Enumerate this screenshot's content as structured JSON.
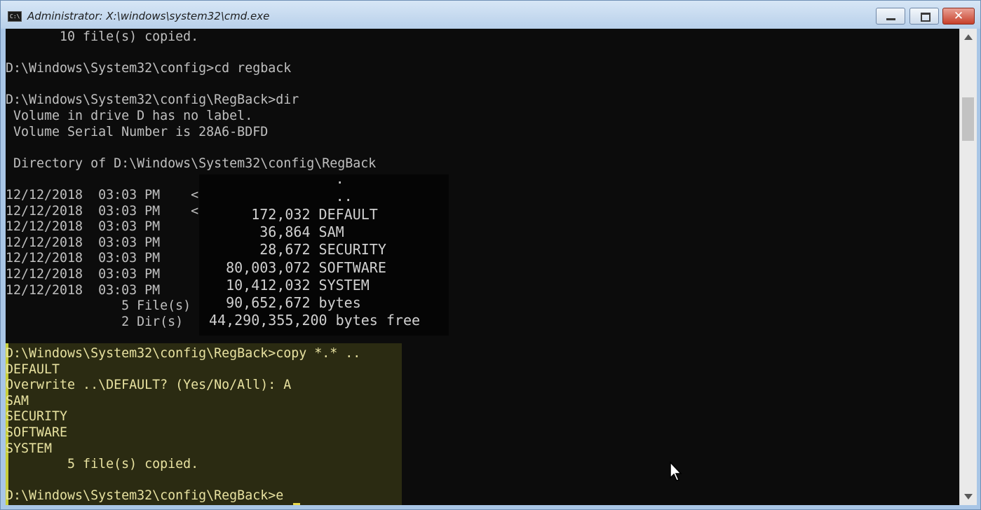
{
  "window": {
    "title": "Administrator: X:\\windows\\system32\\cmd.exe",
    "icon": "cmd-icon",
    "icon_text": "C:\\",
    "controls": {
      "minimize": "minimize-icon",
      "maximize": "maximize-icon",
      "close": "close-icon",
      "close_glyph": "✕"
    }
  },
  "colors": {
    "console_bg": "#0c0c0c",
    "console_text": "#c0c0c0",
    "highlight_text": "#e8e2a0",
    "highlight_border": "#c9cf3c",
    "cursor": "#e8d84a"
  },
  "console": {
    "lines": [
      "       10 file(s) copied.",
      "",
      "D:\\Windows\\System32\\config>cd regback",
      "",
      "D:\\Windows\\System32\\config\\RegBack>dir",
      " Volume in drive D has no label.",
      " Volume Serial Number is 28A6-BDFD",
      "",
      " Directory of D:\\Windows\\System32\\config\\RegBack",
      "",
      "12/12/2018  03:03 PM    <",
      "12/12/2018  03:03 PM    <",
      "12/12/2018  03:03 PM",
      "12/12/2018  03:03 PM",
      "12/12/2018  03:03 PM",
      "12/12/2018  03:03 PM",
      "12/12/2018  03:03 PM",
      "               5 File(s)",
      "               2 Dir(s)",
      "",
      "D:\\Windows\\System32\\config\\RegBack>copy *.* ..",
      "DEFAULT",
      "Overwrite ..\\DEFAULT? (Yes/No/All): A",
      "SAM",
      "SECURITY",
      "SOFTWARE",
      "SYSTEM",
      "        5 file(s) copied.",
      "",
      "D:\\Windows\\System32\\config\\RegBack>e"
    ],
    "zoom_lines": [
      "               .",
      "               ..",
      "     172,032 DEFAULT",
      "      36,864 SAM",
      "      28,672 SECURITY",
      "  80,003,072 SOFTWARE",
      "  10,412,032 SYSTEM",
      "  90,652,672 bytes",
      "44,290,355,200 bytes free"
    ]
  },
  "scrollbar": {
    "up": "scroll-up-arrow-icon",
    "down": "scroll-down-arrow-icon"
  },
  "pointer": "mouse-pointer-icon"
}
